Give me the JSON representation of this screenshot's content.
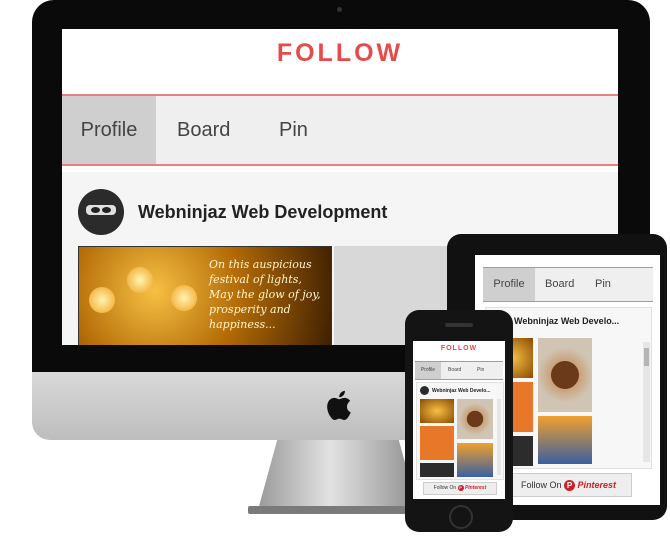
{
  "widget": {
    "title": "FOLLOW",
    "tabs": [
      "Profile",
      "Board",
      "Pin"
    ],
    "active_tab": "Profile",
    "profile_name": "Webninjaz Web Development",
    "profile_name_tablet": "Webninjaz Web Develo...",
    "profile_name_phone": "Webninjaz Web Develo...",
    "follow_on": "Follow On",
    "pinterest": "Pinterest",
    "pinterest_logo_letter": "P",
    "pin_caption_lines": [
      "On this auspicious",
      "festival of lights,",
      "May the glow of joy,",
      "prosperity and happiness..."
    ]
  },
  "colors": {
    "accent": "#e84a4a",
    "tab_border": "#e88080",
    "pinterest_red": "#cb2027"
  },
  "icons": [
    "apple-logo-icon",
    "ninja-avatar-icon",
    "pinterest-logo-icon"
  ]
}
